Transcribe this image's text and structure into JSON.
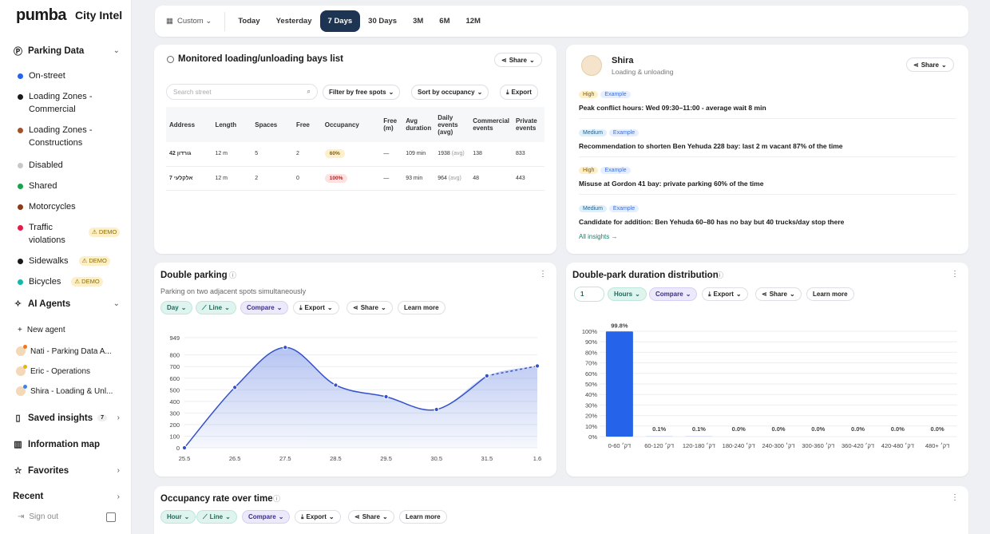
{
  "brand": {
    "logo": "pumba",
    "product": "City Intel"
  },
  "sidebar": {
    "parking_title": "Parking Data",
    "items": [
      {
        "label": "On-street",
        "color": "#2563eb",
        "demo": ""
      },
      {
        "label": "Loading Zones - Commercial",
        "color": "#1a1a1a",
        "demo": ""
      },
      {
        "label": "Loading Zones - Constructions",
        "color": "#a0522d",
        "demo": ""
      },
      {
        "label": "Disabled",
        "color": "#c8c8c8",
        "demo": ""
      },
      {
        "label": "Shared",
        "color": "#16a34a",
        "demo": ""
      },
      {
        "label": "Motorcycles",
        "color": "#8b3a1a",
        "demo": ""
      },
      {
        "label": "Traffic violations",
        "color": "#e11d48",
        "demo": "DEMO"
      },
      {
        "label": "Sidewalks",
        "color": "#1a1a1a",
        "demo": "DEMO"
      },
      {
        "label": "Bicycles",
        "color": "#14b8a6",
        "demo": "DEMO"
      }
    ],
    "agents_title": "AI Agents",
    "new_agent": "New agent",
    "agents": [
      {
        "label": "Nati - Parking Data A...",
        "color": "#f97316"
      },
      {
        "label": "Eric - Operations",
        "color": "#eab308"
      },
      {
        "label": "Shira - Loading & Unl...",
        "color": "#3b82f6"
      }
    ],
    "saved_insights": "Saved insights",
    "saved_count": "7",
    "info_map": "Information map",
    "favorites": "Favorites",
    "recent": "Recent",
    "sign_out": "Sign out"
  },
  "topbar": {
    "custom": "Custom",
    "ranges": [
      "Today",
      "Yesterday",
      "7 Days",
      "30 Days",
      "3M",
      "6M",
      "12M"
    ],
    "active": "7 Days"
  },
  "bays": {
    "title": "Monitored loading/unloading bays list",
    "share": "Share",
    "search_placeholder": "Search street",
    "filter": "Filter by free spots",
    "sort": "Sort by occupancy",
    "export": "Export",
    "columns": [
      "Address",
      "Length",
      "Spaces",
      "Free",
      "Occupancy",
      "Free (m)",
      "Avg duration",
      "Daily events (avg)",
      "Commercial events",
      "Private events"
    ],
    "rows": [
      {
        "address": "גורדון 42",
        "length": "12 m",
        "spaces": "5",
        "free": "2",
        "occupancy": "60%",
        "free_m": "—",
        "avg": "109 min",
        "daily": "1938",
        "daily_unit": "(avg)",
        "commercial": "138",
        "private": "833"
      },
      {
        "address": "אלקלעי 7",
        "length": "12 m",
        "spaces": "2",
        "free": "0",
        "occupancy": "100%",
        "free_m": "—",
        "avg": "93 min",
        "daily": "964",
        "daily_unit": "(avg)",
        "commercial": "48",
        "private": "443"
      }
    ]
  },
  "shira": {
    "name": "Shira",
    "role": "Loading & unloading",
    "share": "Share",
    "insights": [
      {
        "level": "High",
        "tag": "Example",
        "text": "Peak conflict hours: Wed 09:30–11:00 - average wait 8 min"
      },
      {
        "level": "Medium",
        "tag": "Example",
        "text": "Recommendation to shorten Ben Yehuda 228 bay: last 2 m vacant 87% of the time"
      },
      {
        "level": "High",
        "tag": "Example",
        "text": "Misuse at Gordon 41 bay: private parking 60% of the time"
      },
      {
        "level": "Medium",
        "tag": "Example",
        "text": "Candidate for addition: Ben Yehuda 60–80 has no bay but 40 trucks/day stop there"
      }
    ],
    "all_link": "All insights →"
  },
  "double_parking": {
    "title": "Double parking",
    "subtitle": "Parking on two adjacent spots simultaneously",
    "controls": {
      "day": "Day",
      "line": "Line",
      "compare": "Compare",
      "export": "Export",
      "share": "Share",
      "learn": "Learn more"
    }
  },
  "duration": {
    "title": "Double-park duration distribution",
    "controls": {
      "num": "1",
      "hours": "Hours",
      "compare": "Compare",
      "export": "Export",
      "share": "Share",
      "learn": "Learn more"
    }
  },
  "occupancy": {
    "title": "Occupancy rate over time",
    "controls": {
      "hour": "Hour",
      "line": "Line",
      "compare": "Compare",
      "export": "Export",
      "share": "Share",
      "learn": "Learn more"
    }
  },
  "chart_data": [
    {
      "type": "line",
      "title": "Double parking",
      "x": [
        "25.5",
        "26.5",
        "27.5",
        "28.5",
        "29.5",
        "30.5",
        "31.5",
        "1.6"
      ],
      "values": [
        0,
        520,
        865,
        540,
        440,
        330,
        620,
        705
      ],
      "yticks": [
        0,
        100,
        200,
        300,
        400,
        500,
        600,
        700,
        800,
        949
      ],
      "ylim": [
        0,
        949
      ],
      "last_segment_dashed": true
    },
    {
      "type": "bar",
      "title": "Double-park duration distribution",
      "categories": [
        "0-60 דק׳",
        "60-120 דק׳",
        "120-180 דק׳",
        "180-240 דק׳",
        "240-300 דק׳",
        "300-360 דק׳",
        "360-420 דק׳",
        "420-480 דק׳",
        "480+ דק׳"
      ],
      "values": [
        99.8,
        0.1,
        0.1,
        0.0,
        0.0,
        0.0,
        0.0,
        0.0,
        0.0
      ],
      "labels": [
        "99.8%",
        "0.1%",
        "0.1%",
        "0.0%",
        "0.0%",
        "0.0%",
        "0.0%",
        "0.0%",
        "0.0%"
      ],
      "yticks": [
        "0%",
        "10%",
        "20%",
        "30%",
        "40%",
        "50%",
        "60%",
        "70%",
        "80%",
        "90%",
        "100%"
      ],
      "ylim": [
        0,
        100
      ]
    }
  ]
}
